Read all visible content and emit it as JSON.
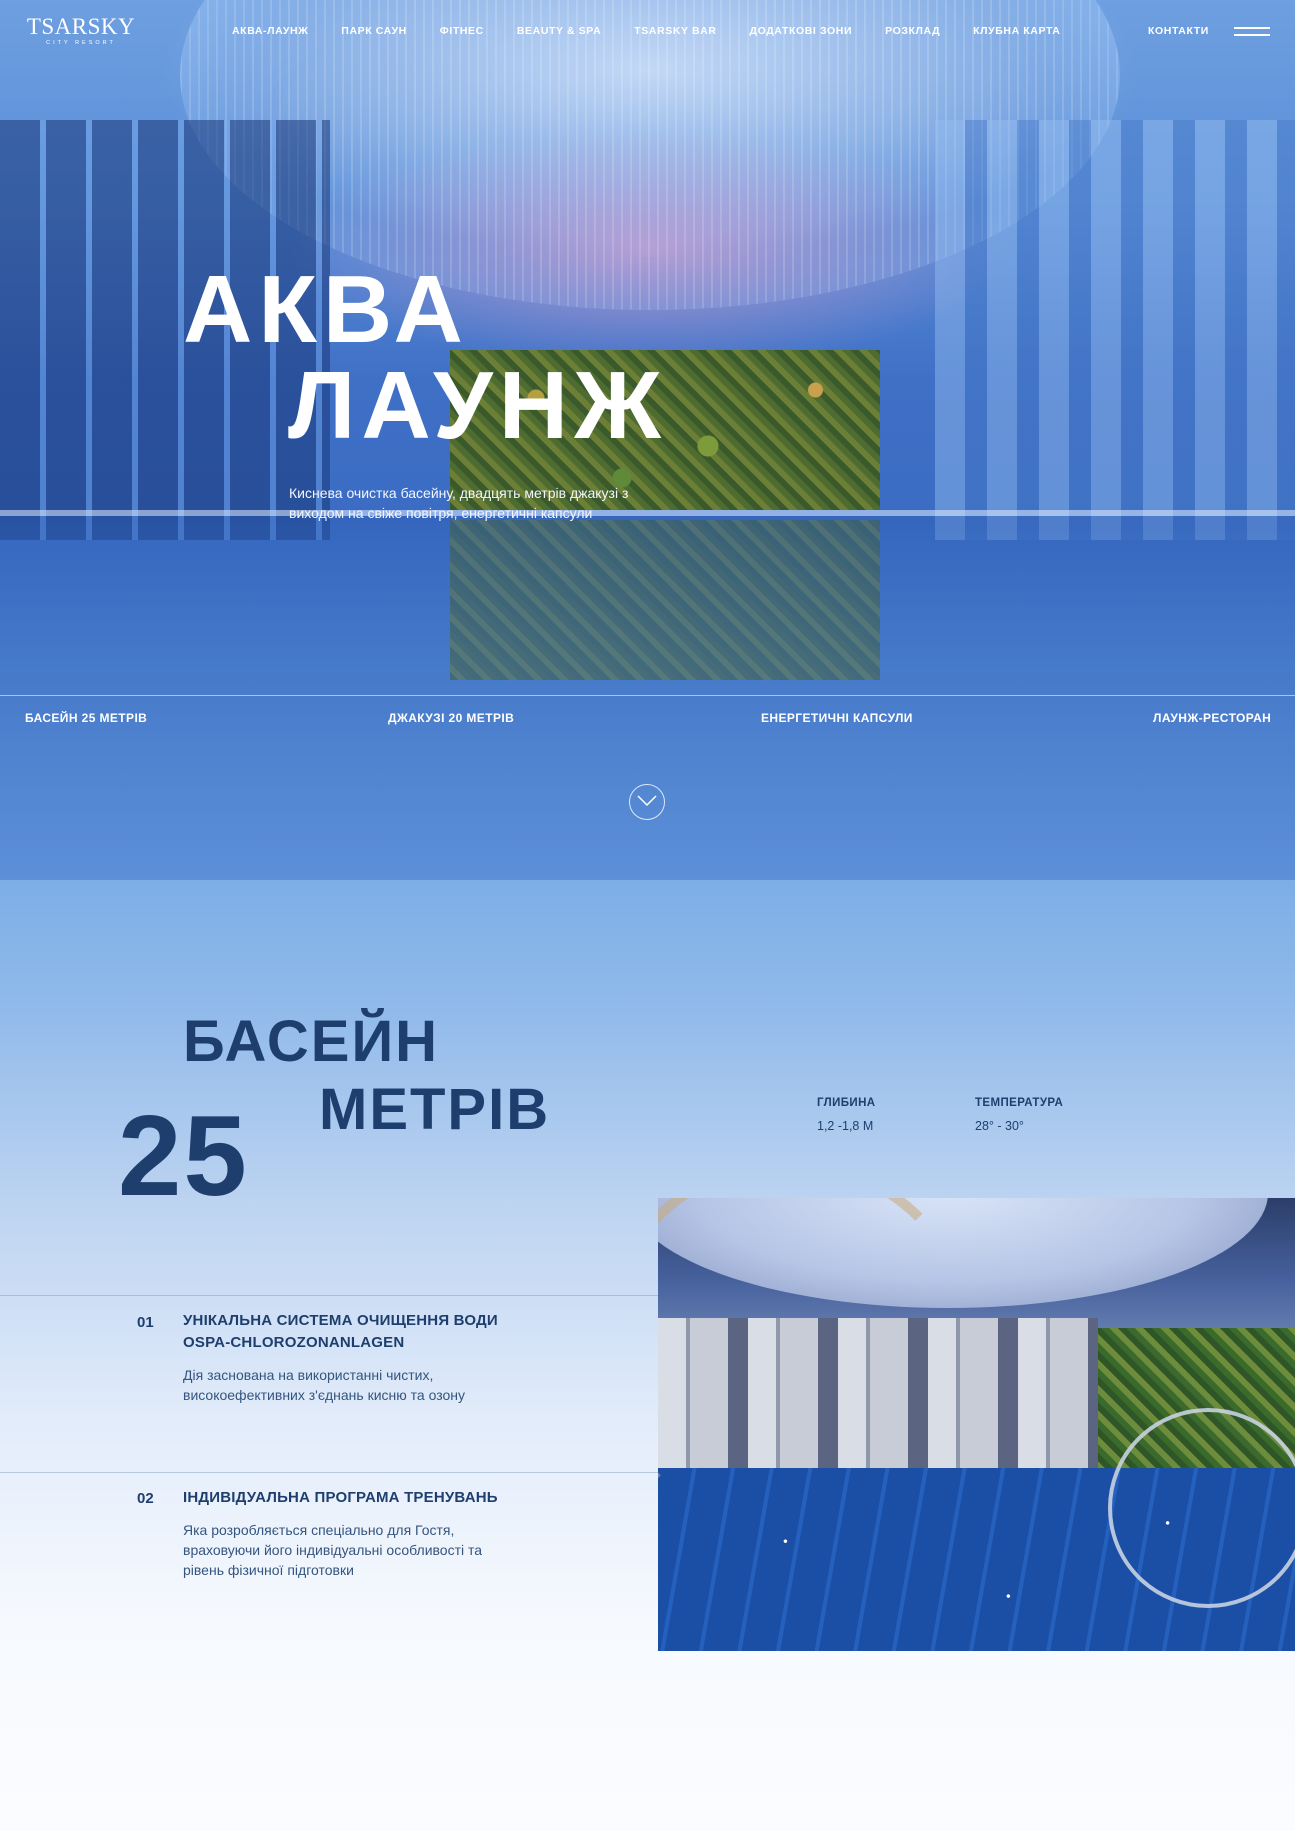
{
  "header": {
    "logo": {
      "main": "TSARSKY",
      "sub": "CITY RESORT"
    },
    "nav": [
      {
        "label": "АКВА-ЛАУНЖ"
      },
      {
        "label": "ПАРК САУН"
      },
      {
        "label": "ФІТНЕС"
      },
      {
        "label": "BEAUTY & SPA"
      },
      {
        "label": "TSARSKY BAR"
      },
      {
        "label": "ДОДАТКОВІ ЗОНИ"
      },
      {
        "label": "РОЗКЛАД"
      },
      {
        "label": "КЛУБНА КАРТА"
      }
    ],
    "contacts_label": "КОНТАКТИ",
    "menu_icon": "hamburger-icon"
  },
  "hero": {
    "title_line1": "АКВА",
    "title_line2": "ЛАУНЖ",
    "subtitle": "Киснева очистка басейну, двадцять метрів джакузі з виходом на свіже повітря, енергетичні капсули",
    "features": [
      {
        "label": "БАСЕЙН 25 МЕТРІВ"
      },
      {
        "label": "ДЖАКУЗІ 20 МЕТРІВ"
      },
      {
        "label": "ЕНЕРГЕТИЧНІ КАПСУЛИ"
      },
      {
        "label": "ЛАУНЖ-РЕСТОРАН"
      }
    ],
    "scroll_icon": "chevron-down-icon"
  },
  "pool": {
    "title_line1": "БАСЕЙН",
    "title_line2": "МЕТРІВ",
    "big_number": "25",
    "stats": [
      {
        "label": "ГЛИБИНА",
        "value": "1,2 -1,8 М"
      },
      {
        "label": "ТЕМПЕРАТУРА",
        "value": "28° - 30°"
      }
    ],
    "items": [
      {
        "num": "01",
        "title": "УНІКАЛЬНА СИСТЕМА ОЧИЩЕННЯ ВОДИ OSPA-CHLOROZONANLAGEN",
        "desc": "Дія заснована на використанні чистих, високоефективних з'єднань кисню та озону"
      },
      {
        "num": "02",
        "title": "ІНДИВІДУАЛЬНА ПРОГРАМА ТРЕНУВАНЬ",
        "desc": "Яка розробляється спеціально для Гостя, враховуючи його індивідуальні особливості та рівень фізичної підготовки"
      }
    ]
  },
  "colors": {
    "accent_dark": "#1e3f6e",
    "hero_blue": "#4a80cd",
    "text_white": "#ffffff"
  }
}
